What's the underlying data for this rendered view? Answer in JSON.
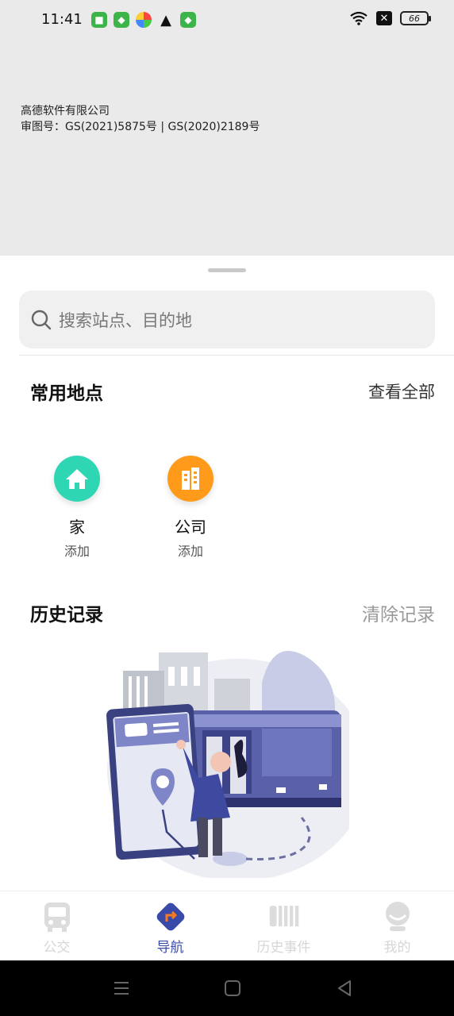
{
  "status_bar": {
    "time": "11:41",
    "battery": "66",
    "left_icons": [
      "android-icon",
      "shield-icon",
      "colorful-app-icon",
      "warning-icon",
      "shield-icon"
    ],
    "right_icons": [
      "wifi-icon",
      "close-box-icon",
      "battery-icon"
    ]
  },
  "map": {
    "credit_line1": "高德软件有限公司",
    "credit_line2": "审图号：GS(2021)5875号 | GS(2020)2189号"
  },
  "search": {
    "placeholder": "搜索站点、目的地"
  },
  "frequent_places": {
    "title": "常用地点",
    "view_all": "查看全部",
    "items": [
      {
        "name": "家",
        "sub": "添加",
        "icon": "home-icon",
        "color": "#2fd6b4"
      },
      {
        "name": "公司",
        "sub": "添加",
        "icon": "building-icon",
        "color": "#ff9a1a"
      }
    ]
  },
  "history": {
    "title": "历史记录",
    "clear": "清除记录"
  },
  "tabs": [
    {
      "label": "公交",
      "icon": "bus-icon",
      "active": false
    },
    {
      "label": "导航",
      "icon": "navigation-icon",
      "active": true
    },
    {
      "label": "历史事件",
      "icon": "history-icon",
      "active": false
    },
    {
      "label": "我的",
      "icon": "profile-icon",
      "active": false
    }
  ],
  "colors": {
    "accent": "#3a4aa8",
    "link_gray": "#9a9a9a",
    "home_green": "#2fd6b4",
    "company_orange": "#ff9a1a"
  }
}
